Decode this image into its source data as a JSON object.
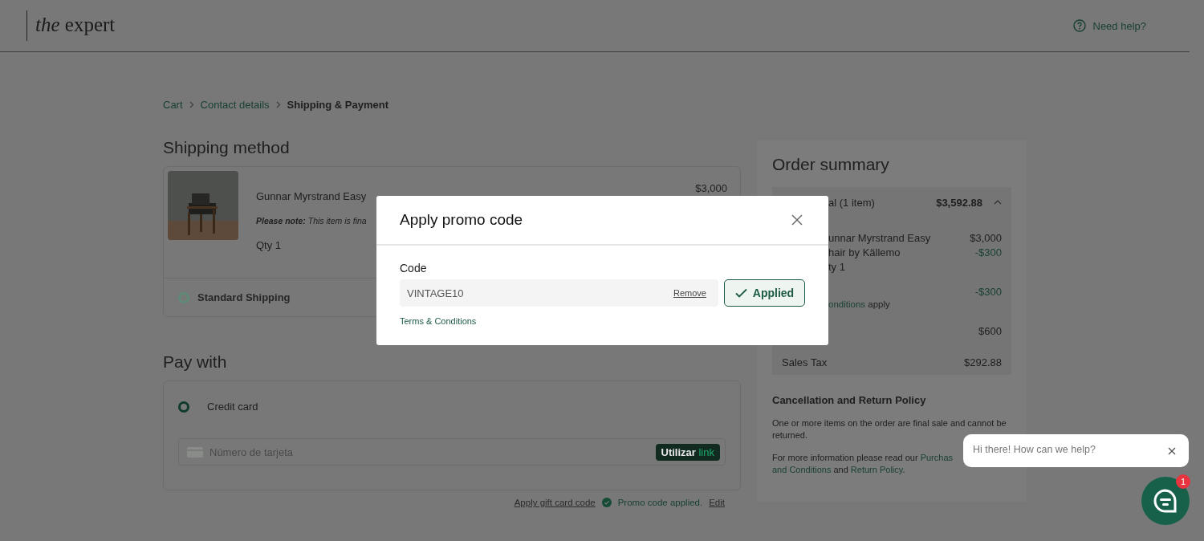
{
  "header": {
    "logo": "*the* expert",
    "help": "Need help?"
  },
  "breadcrumb": [
    {
      "label": "Cart",
      "current": false
    },
    {
      "label": "Contact details",
      "current": false
    },
    {
      "label": "Shipping & Payment",
      "current": true
    }
  ],
  "shipping": {
    "title": "Shipping method",
    "product": {
      "name": "Gunnar Myrstrand Easy",
      "note": "**Please note:** This item is fina",
      "qty": "Qty 1",
      "price": "$3,000"
    },
    "options": [
      {
        "label": "Standard Shipping",
        "selected": false
      }
    ]
  },
  "payment": {
    "title": "Pay with",
    "options": [
      {
        "label": "Credit card",
        "selected": true
      }
    ],
    "card_placeholder": "Número de tarjeta",
    "link_button": {
      "word": "Utilizar",
      "brand": "link"
    },
    "gift_link": "Apply gift card code",
    "promo_status": "Promo code applied.",
    "edit_link": "Edit"
  },
  "summary": {
    "title": "Order summary",
    "total_label": "al (1 item)",
    "total": "$3,592.88",
    "expanded": true,
    "rows": [
      {
        "kind": "item",
        "lines": [
          "unnar Myrstrand Easy",
          "hair by Källemo",
          "ty 1"
        ],
        "price": "$3,000",
        "discount": "-$300"
      },
      {
        "kind": "promo",
        "amount": "-$300",
        "link": "onditions",
        "rest": " apply"
      },
      {
        "kind": "line",
        "amount": "$600"
      },
      {
        "kind": "line",
        "label": "Sales Tax",
        "amount": "$292.88"
      }
    ],
    "policy_title": "Cancellation and Return Policy",
    "policy_text": "One or more items on the order are final sale and cannot be returned.",
    "info": {
      "before": "For more information please read our ",
      "link1": "Purchas",
      "link2": "and Conditions",
      "middle": " and ",
      "link3": "Return Policy",
      "after": "."
    }
  },
  "modal": {
    "title": "Apply promo code",
    "field_label": "Code",
    "value": "VINTAGE10",
    "remove": "Remove",
    "button": "Applied",
    "applied": true,
    "terms": "Terms & Conditions"
  },
  "chat": {
    "message": "Hi there! How can we help?",
    "badge": "1"
  }
}
